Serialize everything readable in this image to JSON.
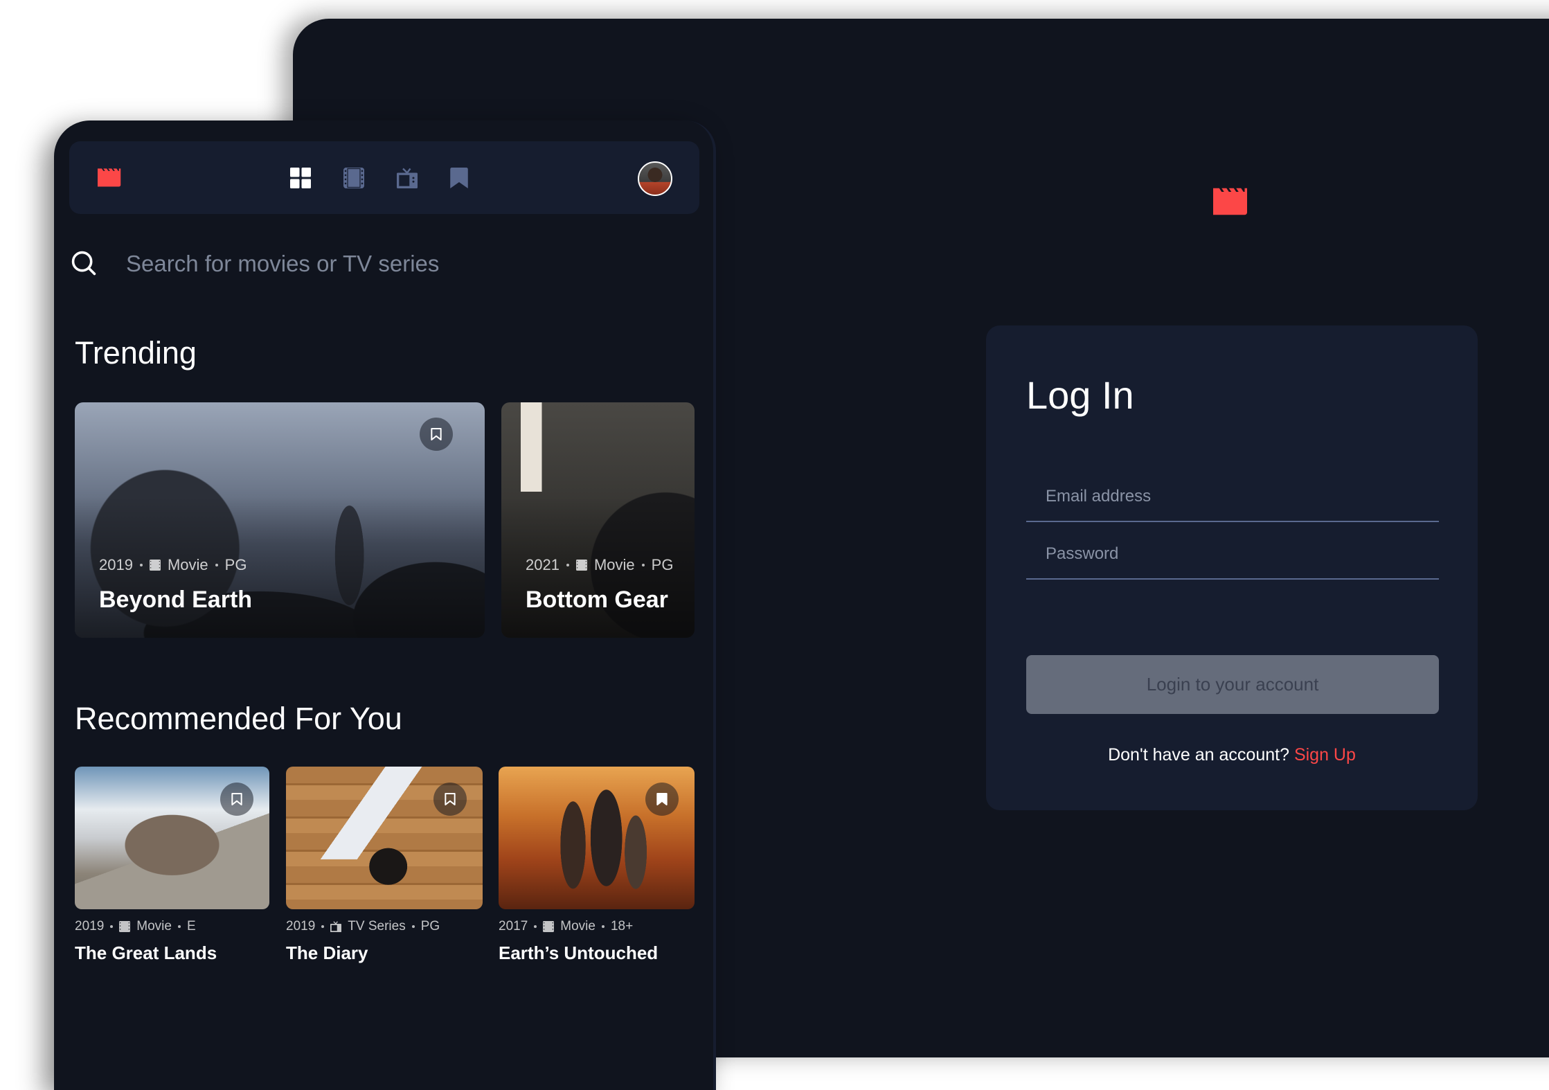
{
  "colors": {
    "accent": "#FC4747",
    "background": "#10141E",
    "surface": "#161D2F",
    "nav_inactive": "#5A698F",
    "nav_active": "#FFFFFF",
    "button_disabled": "#656C7B"
  },
  "nav": {
    "logo_icon": "clapperboard-icon",
    "items": [
      {
        "name": "home",
        "icon": "grid-icon",
        "active": true
      },
      {
        "name": "movies",
        "icon": "film-icon",
        "active": false
      },
      {
        "name": "tv-series",
        "icon": "tv-icon",
        "active": false
      },
      {
        "name": "bookmarks",
        "icon": "bookmark-icon",
        "active": false
      }
    ],
    "avatar": "user-avatar"
  },
  "search": {
    "placeholder": "Search for movies or TV series",
    "value": ""
  },
  "trending": {
    "title": "Trending",
    "items": [
      {
        "year": "2019",
        "category": "Movie",
        "category_icon": "film-icon",
        "rating": "PG",
        "title": "Beyond Earth",
        "bookmarked": false
      },
      {
        "year": "2021",
        "category": "Movie",
        "category_icon": "film-icon",
        "rating": "PG",
        "title": "Bottom Gear",
        "bookmarked": false
      }
    ]
  },
  "recommended": {
    "title": "Recommended For You",
    "items": [
      {
        "year": "2019",
        "category": "Movie",
        "category_icon": "film-icon",
        "rating": "E",
        "title": "The Great Lands",
        "bookmarked": false
      },
      {
        "year": "2019",
        "category": "TV Series",
        "category_icon": "tv-icon",
        "rating": "PG",
        "title": "The Diary",
        "bookmarked": false
      },
      {
        "year": "2017",
        "category": "Movie",
        "category_icon": "film-icon",
        "rating": "18+",
        "title": "Earth’s Untouched",
        "bookmarked": true
      }
    ]
  },
  "login": {
    "logo_icon": "clapperboard-icon",
    "title": "Log In",
    "email_placeholder": "Email address",
    "email_value": "",
    "password_placeholder": "Password",
    "password_value": "",
    "submit_label": "Login to your account",
    "no_account_text": "Don't have an account?",
    "signup_label": "Sign Up"
  }
}
